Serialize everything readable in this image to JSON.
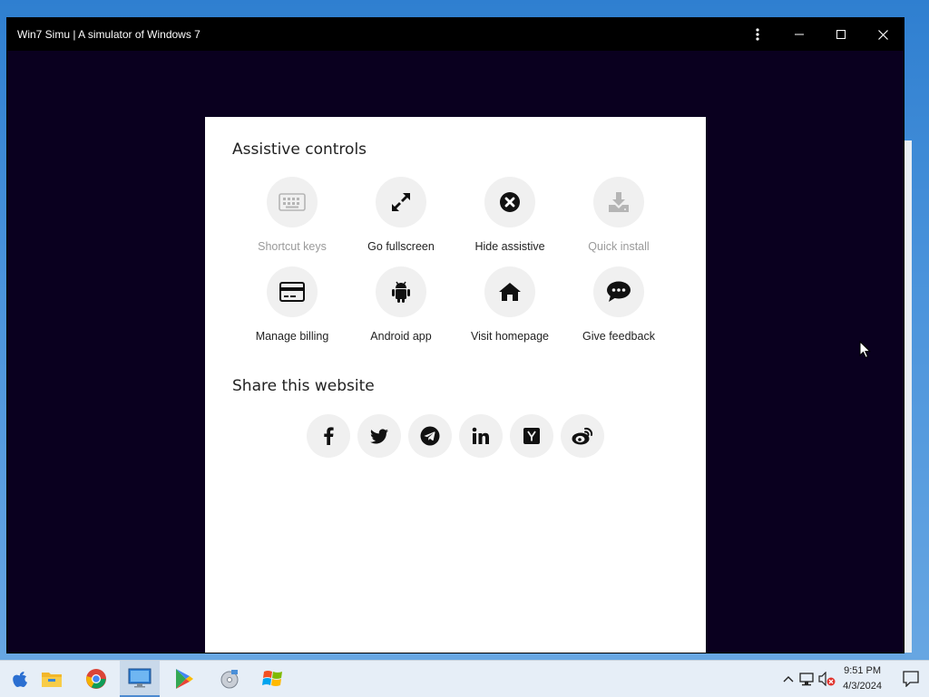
{
  "window": {
    "title": "Win7 Simu | A simulator of Windows 7"
  },
  "assistive": {
    "heading": "Assistive controls",
    "tiles": [
      {
        "label": "Shortcut keys",
        "icon": "keyboard-icon",
        "disabled": true
      },
      {
        "label": "Go fullscreen",
        "icon": "expand-icon",
        "disabled": false
      },
      {
        "label": "Hide assistive",
        "icon": "close-circle-icon",
        "disabled": false
      },
      {
        "label": "Quick install",
        "icon": "download-icon",
        "disabled": true
      },
      {
        "label": "Manage billing",
        "icon": "credit-card-icon",
        "disabled": false
      },
      {
        "label": "Android app",
        "icon": "android-icon",
        "disabled": false
      },
      {
        "label": "Visit homepage",
        "icon": "home-icon",
        "disabled": false
      },
      {
        "label": "Give feedback",
        "icon": "chat-icon",
        "disabled": false
      }
    ]
  },
  "share": {
    "heading": "Share this website",
    "buttons": [
      "facebook-icon",
      "twitter-icon",
      "telegram-icon",
      "linkedin-icon",
      "hacker-news-icon",
      "weibo-icon"
    ]
  },
  "taskbar": {
    "time": "9:51 PM",
    "date": "4/3/2024"
  },
  "colors": {
    "overlay": "#0a001f",
    "titlebar": "#000000",
    "disabled_text": "#9a9a9a"
  }
}
